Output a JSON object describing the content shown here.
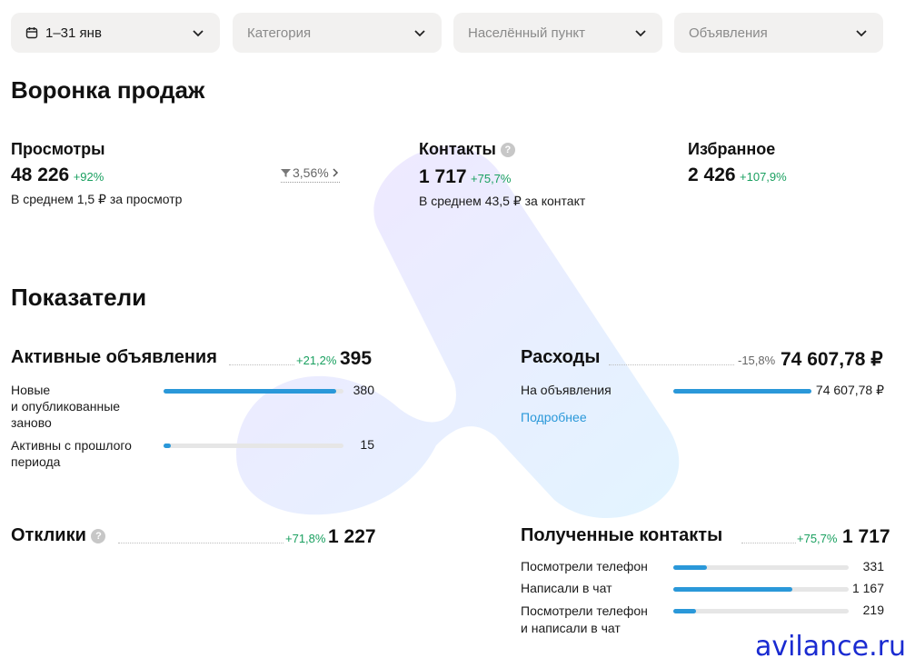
{
  "filters": {
    "date": "1–31 янв",
    "category": "Категория",
    "locality": "Населённый пункт",
    "ads": "Объявления"
  },
  "funnel": {
    "title": "Воронка продаж",
    "views": {
      "label": "Просмотры",
      "value": "48 226",
      "delta": "+92%",
      "avg": "В среднем 1,5 ₽ за просмотр"
    },
    "conversion": "3,56%",
    "contacts": {
      "label": "Контакты",
      "value": "1 717",
      "delta": "+75,7%",
      "avg": "В среднем 43,5 ₽ за контакт"
    },
    "favorites": {
      "label": "Избранное",
      "value": "2 426",
      "delta": "+107,9%"
    }
  },
  "indicators": {
    "title": "Показатели",
    "active_ads": {
      "label": "Активные объявления",
      "delta": "+21,2%",
      "value": "395",
      "rows": [
        {
          "label_line1": "Новые",
          "label_line2": "и опубликованные",
          "label_line3": "заново",
          "value": "380",
          "fraction": 0.962
        },
        {
          "label_line1": "Активны с прошлого",
          "label_line2": "периода",
          "value": "15",
          "fraction": 0.038
        }
      ]
    },
    "expenses": {
      "label": "Расходы",
      "delta": "-15,8%",
      "value": "74 607,78 ₽",
      "rows": [
        {
          "label": "На объявления",
          "value": "74 607,78 ₽",
          "fraction": 1.0
        }
      ],
      "more_link": "Подробнее"
    },
    "responses": {
      "label": "Отклики",
      "delta": "+71,8%",
      "value": "1 227"
    },
    "received_contacts": {
      "label": "Полученные контакты",
      "delta": "+75,7%",
      "value": "1 717",
      "rows": [
        {
          "label_line1": "Посмотрели телефон",
          "value": "331",
          "fraction": 0.193
        },
        {
          "label_line1": "Написали в чат",
          "value": "1 167",
          "fraction": 0.68
        },
        {
          "label_line1": "Посмотрели телефон",
          "label_line2": "и написали в чат",
          "value": "219",
          "fraction": 0.128
        }
      ]
    }
  },
  "watermark": "avilance.ru",
  "colors": {
    "accent_blue": "#2a98d9",
    "positive_green": "#1aa060",
    "filter_bg": "#f2f1f0"
  }
}
